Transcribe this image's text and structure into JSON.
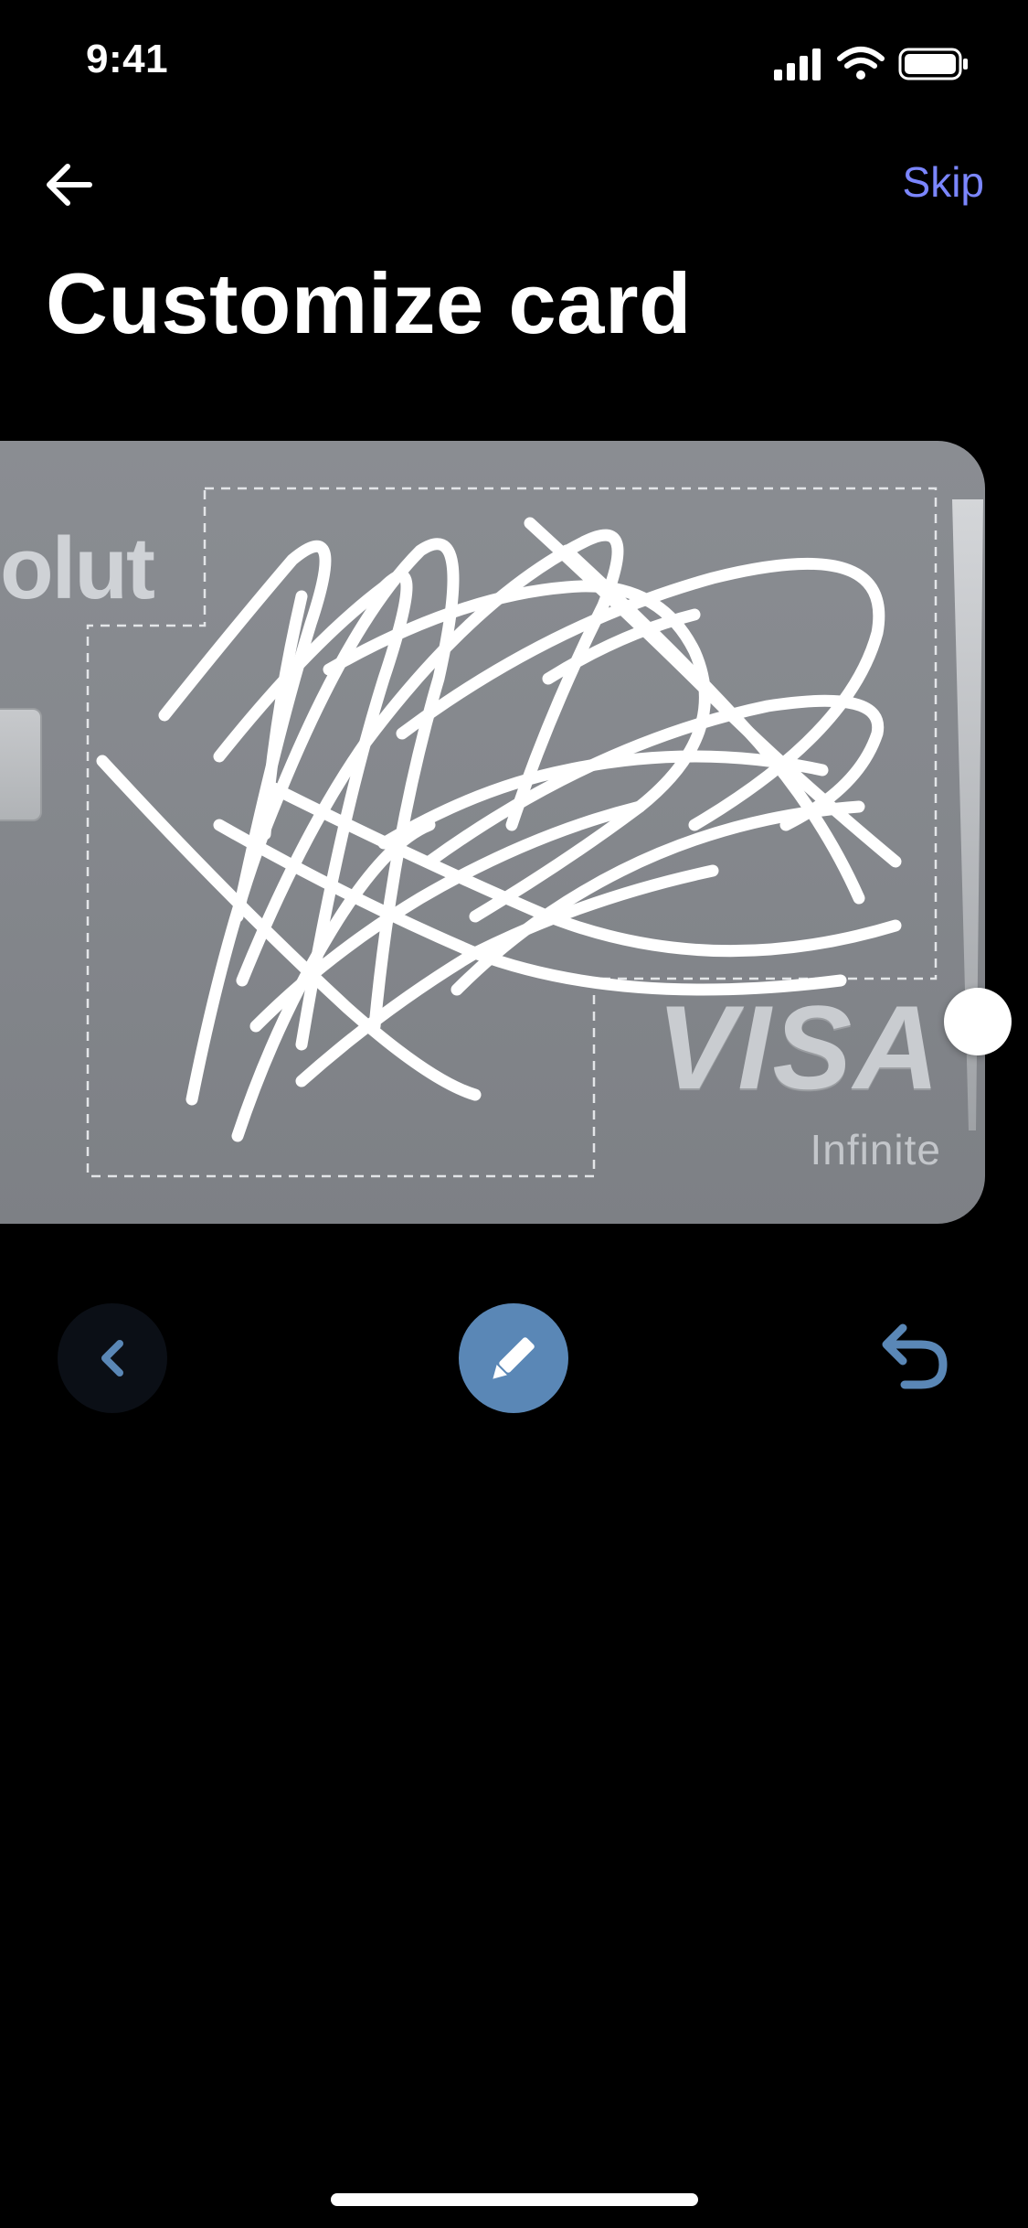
{
  "status_bar": {
    "time": "9:41"
  },
  "header": {
    "skip_label": "Skip"
  },
  "title": "Customize card",
  "card": {
    "brand_text": "olut",
    "network_logo": "VISA",
    "network_tier": "Infinite",
    "colors": {
      "card": "#85888d",
      "signature": "#ffffff",
      "accent": "#7b86ff",
      "edit_button": "#5a87b6"
    }
  },
  "controls": {
    "prev_icon": "chevron-left-icon",
    "edit_icon": "pencil-icon",
    "undo_icon": "undo-icon"
  }
}
